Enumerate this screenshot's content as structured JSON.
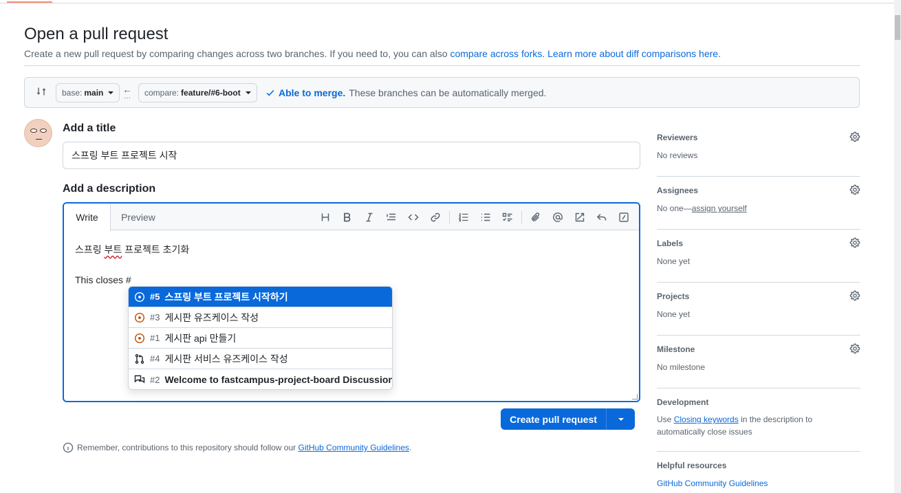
{
  "header": {
    "title": "Open a pull request",
    "subtitle_text": "Create a new pull request by comparing changes across two branches. If you need to, you can also ",
    "compare_forks_link": "compare across forks.",
    "learn_more_link": "Learn more about diff comparisons here."
  },
  "range": {
    "base_label": "base:",
    "base_value": "main",
    "compare_label": "compare:",
    "compare_value": "feature/#6-boot",
    "status_ok": "Able to merge.",
    "status_text": "These branches can be automatically merged."
  },
  "form": {
    "title_label": "Add a title",
    "title_value": "스프링 부트 프로젝트 시작",
    "desc_label": "Add a description",
    "tabs": [
      {
        "label": "Write"
      },
      {
        "label": "Preview"
      }
    ],
    "body_line1_a": "스프링 ",
    "body_line1_b": "부트",
    "body_line1_c": " 프로젝트 초기화",
    "body_line2": "This closes #"
  },
  "suggestions": [
    {
      "num": "#5",
      "name": "스프링 부트 프로젝트 시작하기",
      "type": "issue-open",
      "selected": true
    },
    {
      "num": "#3",
      "name": "게시판 유즈케이스 작성",
      "type": "issue-open",
      "selected": false
    },
    {
      "num": "#1",
      "name": "게시판 api 만들기",
      "type": "issue-open",
      "selected": false
    },
    {
      "num": "#4",
      "name": "게시판 서비스 유즈케이스 작성",
      "type": "pull-request",
      "selected": false
    },
    {
      "num": "#2",
      "name": "Welcome to fastcampus-project-board Discussions!",
      "type": "discussion",
      "selected": false
    }
  ],
  "actions": {
    "create_label": "Create pull request"
  },
  "footer": {
    "note_text": "Remember, contributions to this repository should follow our ",
    "note_link": "GitHub Community Guidelines",
    "note_end": "."
  },
  "sidebar": {
    "reviewers": {
      "title": "Reviewers",
      "value": "No reviews"
    },
    "assignees": {
      "title": "Assignees",
      "value_prefix": "No one—",
      "value_link": "assign yourself"
    },
    "labels": {
      "title": "Labels",
      "value": "None yet"
    },
    "projects": {
      "title": "Projects",
      "value": "None yet"
    },
    "milestone": {
      "title": "Milestone",
      "value": "No milestone"
    },
    "development": {
      "title": "Development",
      "text_use": "Use ",
      "text_link": "Closing keywords",
      "text_rest1": " in the description to",
      "text_rest2": "automatically close issues"
    },
    "helpful": {
      "title": "Helpful resources",
      "link": "GitHub Community Guidelines"
    }
  },
  "colors": {
    "accent": "#0969da",
    "issue_open": "#bc4c00",
    "border": "#d0d7de",
    "muted": "#59636e"
  }
}
